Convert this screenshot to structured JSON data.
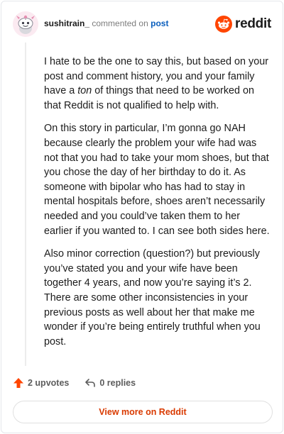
{
  "header": {
    "username": "sushitrain_",
    "action_text": "commented on",
    "post_link": "post",
    "brand_name": "reddit",
    "brand_color": "#ff4500",
    "avatar_icon": "snoo-avatar-icon"
  },
  "comment": {
    "paragraphs": [
      {
        "segments": [
          {
            "text": "I hate to be the one to say this, but based on your post and comment history, you and your family have a ",
            "italic": false
          },
          {
            "text": "ton",
            "italic": true
          },
          {
            "text": " of things that need to be worked on that Reddit is not qualified to help with.",
            "italic": false
          }
        ]
      },
      {
        "segments": [
          {
            "text": "On this story in particular, I’m gonna go NAH because clearly the problem your wife had was not that you had to take your mom shoes, but that you chose the day of her birthday to do it. As someone with bipolar who has had to stay in mental hospitals before, shoes aren’t necessarily needed and you could’ve taken them to her earlier if you wanted to. I can see both sides here.",
            "italic": false
          }
        ]
      },
      {
        "segments": [
          {
            "text": "Also minor correction (question?) but previously you’ve stated you and your wife have been together 4 years, and now you’re saying it’s 2. There are some other inconsistencies in your previous posts as well about her that make me wonder if you’re being entirely truthful when you post.",
            "italic": false
          }
        ]
      }
    ]
  },
  "actions": {
    "upvotes_label": "2 upvotes",
    "upvote_icon": "upvote-arrow-icon",
    "upvote_color": "#ff4500",
    "replies_label": "0 replies",
    "reply_icon": "reply-arrow-icon"
  },
  "footer": {
    "view_more_label": "View more on Reddit",
    "view_more_color": "#d93a00"
  }
}
